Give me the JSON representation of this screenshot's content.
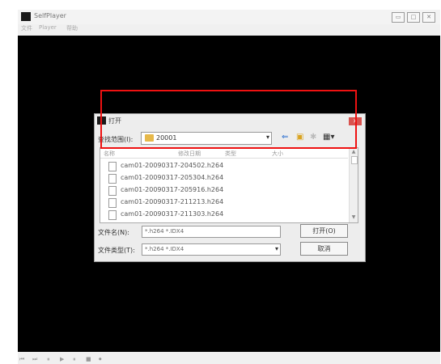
{
  "app": {
    "title": "SelfPlayer",
    "menu": [
      "文件",
      "Player",
      "帮助"
    ],
    "window_buttons": [
      "▭",
      "□",
      "✕"
    ]
  },
  "dialog": {
    "title": "打开",
    "close": "✕",
    "lookin_label": "查找范围(I):",
    "lookin_value": "20001",
    "toolbar": [
      "⇐",
      "▣",
      "✱",
      "▦▾"
    ],
    "columns": [
      "名称",
      "修改日期",
      "类型",
      "大小"
    ],
    "files": [
      "cam01-20090317-204502.h264",
      "cam01-20090317-205304.h264",
      "cam01-20090317-205916.h264",
      "cam01-20090317-211213.h264",
      "cam01-20090317-211303.h264"
    ],
    "filename_label": "文件名(N):",
    "filename_value": "*.h264 *.IDX4",
    "filetype_label": "文件类型(T):",
    "filetype_value": "*.h264 *.IDX4",
    "open_button": "打开(O)",
    "cancel_button": "取消"
  },
  "controls": [
    "⏮",
    "⏭",
    "⏸",
    "▶",
    "⏸",
    "■",
    "⏺"
  ],
  "colors": {
    "video": "#000000",
    "highlight": "#ee1111",
    "folder": "#e6b84a",
    "close": "#d9534f"
  }
}
